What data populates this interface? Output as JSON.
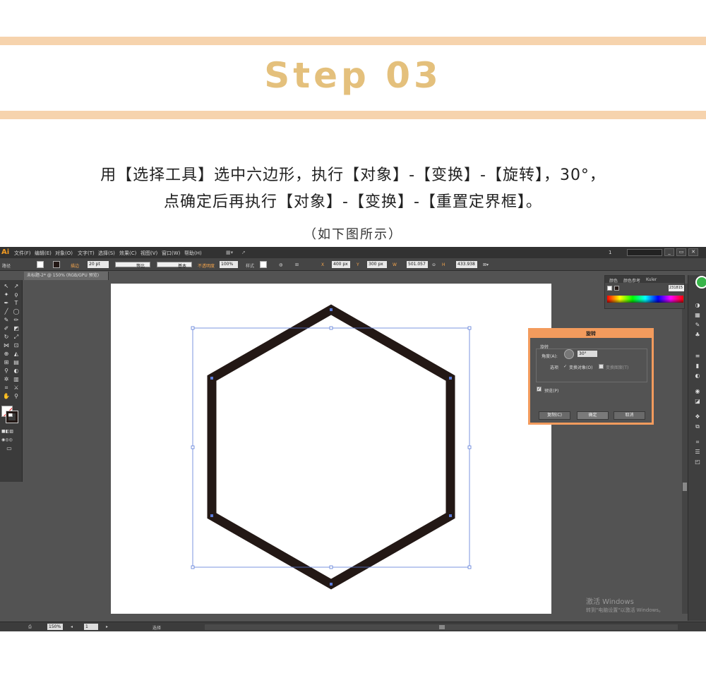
{
  "header": {
    "title": "Step 03"
  },
  "instructions": {
    "line1": "用【选择工具】选中六边形，执行【对象】-【变换】-【旋转】，30°，",
    "line2": "点确定后再执行【对象】-【变换】-【重置定界框】。",
    "caption": "（如下图所示）"
  },
  "ai": {
    "logo": "Ai",
    "menu": [
      "文件(F)",
      "编辑(E)",
      "对象(O)",
      "文字(T)",
      "选择(S)",
      "效果(C)",
      "视图(V)",
      "窗口(W)",
      "帮助(H)"
    ],
    "workspace": "1",
    "window_buttons": [
      "_",
      "▭",
      "✕"
    ],
    "control": {
      "selection_label": "路径",
      "stroke_label": "描边",
      "stroke_weight": "20 pt",
      "profile": "等比",
      "brush": "基本",
      "opacity_label": "不透明度",
      "opacity": "100%",
      "style_label": "样式",
      "x_value": "400 px",
      "y_value": "300 px",
      "w_value": "501.057",
      "h_value": "433.938"
    },
    "doc_tab": "未标题-2* @ 150% (RGB/GPU 预览)",
    "color_panel": {
      "tabs": [
        "颜色",
        "颜色参考",
        "Kuler"
      ],
      "hex": "231815"
    },
    "rotate_dialog": {
      "title": "旋转",
      "group_label": "旋转",
      "angle_label": "角度(A):",
      "angle_value": "30°",
      "options_label": "选项",
      "transform_objects": "变换对象(O)",
      "transform_patterns": "变换图案(T)",
      "preview_label": "预览(P)",
      "copy_button": "复制(C)",
      "ok_button": "确定",
      "cancel_button": "取消"
    },
    "status": {
      "zoom": "150%",
      "page": "1",
      "tool": "选择"
    },
    "watermark": {
      "line1": "激活 Windows",
      "line2": "转到\"电脑设置\"以激活 Windows。"
    }
  },
  "colors": {
    "accent": "#e4c07c",
    "stripe": "#f6d3ad",
    "dialog_border": "#f39b5d",
    "hexagon_stroke": "#231815",
    "bounding_box": "#5b7bd8"
  }
}
